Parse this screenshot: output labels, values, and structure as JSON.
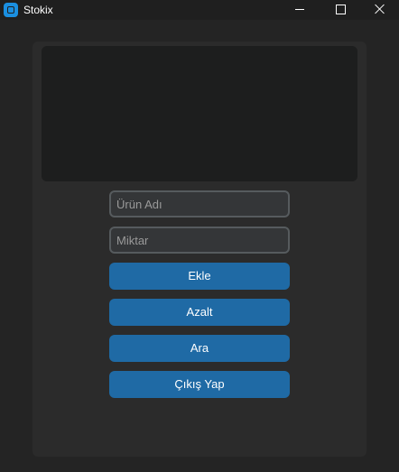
{
  "window": {
    "title": "Stokix",
    "icon": "app-icon",
    "controls": {
      "minimize_icon": "minimize-icon",
      "maximize_icon": "maximize-icon",
      "close_icon": "close-icon"
    }
  },
  "colors": {
    "background": "#242424",
    "panel": "#2b2b2b",
    "textbox": "#1d1e1e",
    "input_bg": "#343638",
    "input_border": "#565b5e",
    "button": "#1f6aa5",
    "app_icon": "#1a8fe0"
  },
  "form": {
    "product_name": {
      "value": "",
      "placeholder": "Ürün Adı"
    },
    "quantity": {
      "value": "",
      "placeholder": "Miktar"
    }
  },
  "buttons": {
    "add_label": "Ekle",
    "decrease_label": "Azalt",
    "search_label": "Ara",
    "logout_label": "Çıkış Yap"
  }
}
